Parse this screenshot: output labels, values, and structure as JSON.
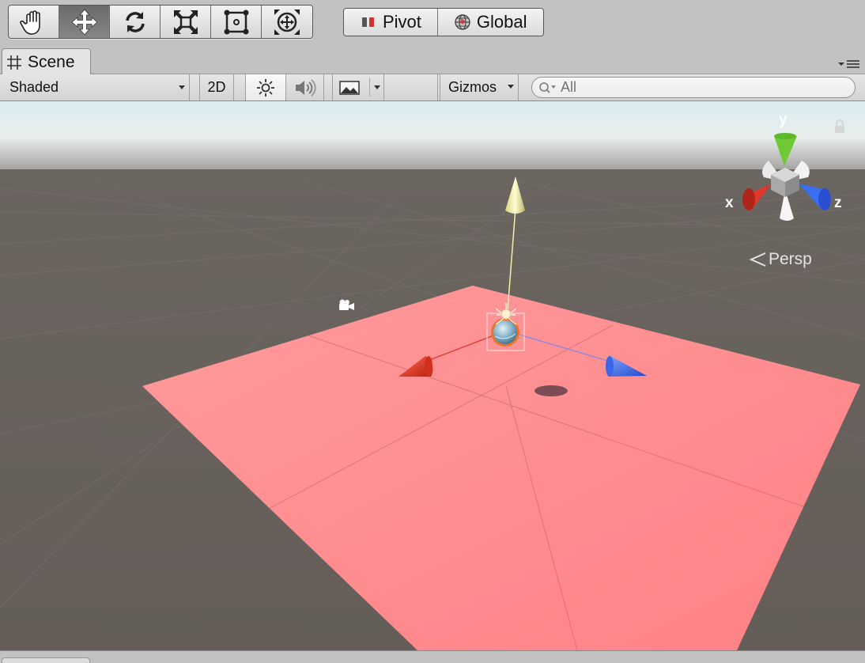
{
  "toolbar": {
    "tools": [
      {
        "name": "hand-tool",
        "icon": "hand-icon"
      },
      {
        "name": "move-tool",
        "icon": "move-arrows-icon",
        "active": true
      },
      {
        "name": "rotate-tool",
        "icon": "rotate-icon"
      },
      {
        "name": "scale-tool",
        "icon": "scale-icon"
      },
      {
        "name": "rect-tool",
        "icon": "rect-transform-icon"
      },
      {
        "name": "transform-tool",
        "icon": "transform-icon"
      }
    ],
    "pivot_label": "Pivot",
    "global_label": "Global"
  },
  "tab": {
    "scene_label": "Scene",
    "scene_icon": "grid-icon"
  },
  "scene_bar": {
    "shading_mode": "Shaded",
    "mode_2d_label": "2D",
    "gizmos_label": "Gizmos",
    "search_placeholder": "All"
  },
  "viewport": {
    "projection_label": "Persp",
    "axis_labels": {
      "x": "x",
      "y": "y",
      "z": "z"
    },
    "colors": {
      "sky": "#dfeef0",
      "ground": "#645d58",
      "plane": "#ff8a8d",
      "x_axis": "#e0382c",
      "y_axis": "#6ec934",
      "z_axis": "#3a6ff0",
      "light_axis": "#f3eeaa"
    }
  }
}
